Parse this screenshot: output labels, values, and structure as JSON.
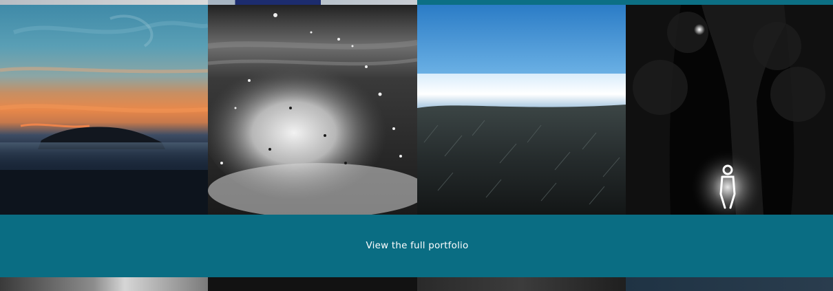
{
  "cta": {
    "label": "View the full portfolio"
  },
  "gallery": {
    "tiles": [
      {
        "scene": "sunset-island-fog"
      },
      {
        "scene": "black-and-white-wave-splash"
      },
      {
        "scene": "sea-meets-grass"
      },
      {
        "scene": "light-painted-figure-in-forest"
      }
    ]
  },
  "colors": {
    "accent": "#0a6d83"
  }
}
